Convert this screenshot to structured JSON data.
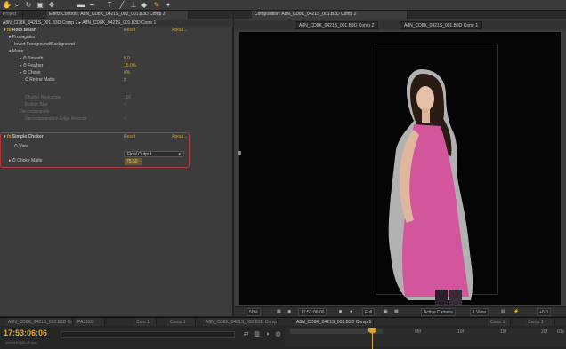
{
  "toolbar": {
    "icons": [
      "hand-icon",
      "zoom-icon",
      "rotate-icon",
      "camera-icon",
      "pan-behind-icon",
      "rectangle-icon",
      "pen-icon",
      "type-icon",
      "brush-icon",
      "clone-icon",
      "eraser-icon",
      "roto-icon",
      "puppet-icon"
    ]
  },
  "left_panel": {
    "tabs": [
      "Project",
      "Effect Controls: A8N_CD8K_0421S_002_001.B3D Comp 2"
    ],
    "breadcrumb": "A8N_CD8K_0421S_001.B3D Comp 2 ▸ A8N_CD8K_0421S_001.B3D Comr 1",
    "effects": {
      "roto_brush": {
        "name": "Roto Brush",
        "reset": "Reset",
        "about": "About...",
        "propagation": "Propagation",
        "invert": "Invert Foreground/Background",
        "matte": "Matte",
        "smooth_label": "Smooth",
        "smooth_value": "0.0",
        "feather_label": "Feather",
        "feather_value": "15.0%",
        "choke_label": "Choke",
        "choke_value": "0%",
        "refine_label": "Refine Matte",
        "refine_value": "□",
        "dim_row1_label": "Chatter Reduction",
        "dim_row1_value": "100",
        "dim_row2_label": "Motion Blur",
        "dim_row2_value": "□",
        "dim_row3_label": "Decontaminate",
        "dim_row4_label": "Decontamination Edge Amount",
        "dim_row4_value": "□"
      },
      "simple_choker": {
        "name": "Simple Choker",
        "reset": "Reset",
        "about": "About...",
        "view_label": "View",
        "view_value": "Final Output",
        "choke_matte_label": "Choke Matte",
        "choke_matte_value": "78.50"
      }
    }
  },
  "right_panel": {
    "tab": "Composition: A8N_CD8K_0421S_001.B3D Comp 2",
    "subtabs": [
      "A8N_CD8K_0421S_001.B3D Comp 2",
      "A8N_CD8K_0421S_001.B3D Comr 1"
    ],
    "viewer_bar": {
      "zoom": "50%",
      "timecode": "17:53:06:06",
      "resolution": "Full",
      "camera": "Active Camera",
      "views": "1 View",
      "exposure": "+0.0"
    }
  },
  "timeline": {
    "tabs": [
      "A8N_CD8K_0421S_002.B3D Comp 1",
      "PASS03",
      "Com 1",
      "Comp 1",
      "A8N_CD8K_0421S_002.B3D Comp 1",
      "A8N_CD8K_0421S_001.B3D Comp 1",
      "Comr 1",
      "Comp 1"
    ],
    "timecode": "17:53:06:06",
    "fps": "1644446 (25.00 fps)",
    "ruler_ticks": [
      "02f",
      "05f",
      "10f",
      "15f",
      "20f",
      "01s"
    ]
  },
  "colors": {
    "accent": "#c9a534",
    "highlight": "#b23a3a",
    "dress": "#d3559b"
  }
}
